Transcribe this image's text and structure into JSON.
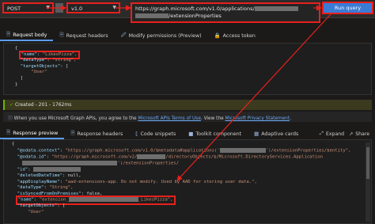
{
  "request": {
    "method": "POST",
    "version": "v1.0",
    "url_line1_prefix": "https://graph.microsoft.com/v1.0/applications/",
    "url_line2": "/extensionProperties",
    "run_label": "Run query"
  },
  "request_tabs": [
    {
      "label": "Request body",
      "icon": "request-body-icon"
    },
    {
      "label": "Request headers",
      "icon": "headers-icon"
    },
    {
      "label": "Modify permissions (Preview)",
      "icon": "permissions-icon"
    },
    {
      "label": "Access token",
      "icon": "token-icon"
    }
  ],
  "request_body": {
    "open": "{",
    "name_key": "\"name\"",
    "name_val": "\"LikesPizza\",",
    "datatype_key": "\"dataType\"",
    "datatype_val": "\"string\",",
    "targets_key": "\"targetObjects\"",
    "targets_open": "[",
    "targets_val": "\"User\"",
    "targets_close": "]",
    "close": "}"
  },
  "status": {
    "text": "Created - 201 - 1762ms"
  },
  "info": {
    "prefix": "When you use Microsoft Graph APIs, you agree to the",
    "terms_link": "Microsoft APIs Terms of Use",
    "middle": ". View the",
    "privacy_link": "Microsoft Privacy Statement",
    "suffix": "."
  },
  "response_tabs": [
    {
      "label": "Response preview",
      "icon": "response-preview-icon"
    },
    {
      "label": "Response headers",
      "icon": "response-headers-icon"
    },
    {
      "label": "Code snippets",
      "icon": "code-snippets-icon"
    },
    {
      "label": "Toolkit component",
      "icon": "toolkit-icon"
    },
    {
      "label": "Adaptive cards",
      "icon": "cards-icon"
    }
  ],
  "response_tools": {
    "expand": "Expand",
    "share": "Share"
  },
  "response_body": {
    "open": "{",
    "context_key": "\"@odata.context\"",
    "context_val_a": "\"https://graph.microsoft.com/v1.0/$metadata#applications('",
    "context_val_b": "')/extensionProperties/$entity\",",
    "id_key": "\"@odata.id\"",
    "id_val_a": "\"https://graph.microsoft.com/v2/",
    "id_val_b": "/directoryObjects/$/Microsoft.DirectoryServices.Application",
    "id_val_c": "')/extensionProperties/",
    "id2_key": "\"id\"",
    "deleted_key": "\"deletedDateTime\"",
    "deleted_val": "null,",
    "appname_key": "\"appDisplayName\"",
    "appname_val": "\"aad-extensions-app. Do not modify. Used by AAD for storing user data.\",",
    "dtype_key": "\"dataType\"",
    "dtype_val": "\"String\",",
    "synced_key": "\"isSyncedFromOnPremises\"",
    "synced_val": "false,",
    "rname_key": "\"name\"",
    "rname_val_a": "\"extension_",
    "rname_val_b": "_LikesPizza\",",
    "rtargets_key": "\"targetObjects\"",
    "rtargets_open": "[",
    "rtargets_val": "\"User\""
  },
  "colors": {
    "annotation": "#e8201c",
    "run_button": "#3a7bd5",
    "success": "#6bb700",
    "json_key": "#9cdcfe",
    "json_string": "#ce9178"
  }
}
